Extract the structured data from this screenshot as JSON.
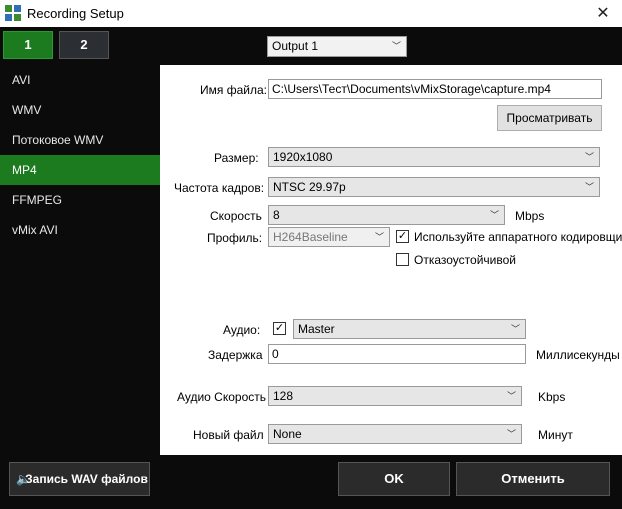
{
  "window": {
    "title": "Recording Setup",
    "close_glyph": "✕"
  },
  "tabs": [
    {
      "label": "1",
      "active": true
    },
    {
      "label": "2",
      "active": false
    }
  ],
  "output_select": {
    "value": "Output 1"
  },
  "formats": [
    {
      "label": "AVI"
    },
    {
      "label": "WMV"
    },
    {
      "label": "Потоковое WMV"
    },
    {
      "label": "MP4",
      "active": true
    },
    {
      "label": "FFMPEG"
    },
    {
      "label": "vMix AVI"
    }
  ],
  "settings": {
    "filename_label": "Имя файла:",
    "filename_value": "C:\\Users\\Тест\\Documents\\vMixStorage\\capture.mp4",
    "browse_label": "Просматривать",
    "size_label": "Размер:",
    "size_value": "1920x1080",
    "framerate_label": "Частота кадров:",
    "framerate_value": "NTSC 29.97p",
    "bitrate_label": "Скорость",
    "bitrate_value": "8",
    "bitrate_unit": "Mbps",
    "profile_label": "Профиль:",
    "profile_value": "H264Baseline",
    "hw_encoder_label": "Используйте аппаратного кодировщика",
    "hw_encoder_checked": true,
    "failsafe_label": "Отказоустойчивой",
    "failsafe_checked": false,
    "audio_label": "Аудио:",
    "audio_checked": true,
    "audio_value": "Master",
    "delay_label": "Задержка",
    "delay_value": "0",
    "delay_unit": "Миллисекунды",
    "audio_bitrate_label": "Аудио Скорость",
    "audio_bitrate_value": "128",
    "audio_bitrate_unit": "Kbps",
    "new_file_label": "Новый файл",
    "new_file_value": "None",
    "new_file_unit": "Минут"
  },
  "footer": {
    "wav_label": "Запись WAV файлов",
    "ok_label": "OK",
    "cancel_label": "Отменить"
  },
  "glyphs": {
    "check": "✓",
    "chevron": "﹀",
    "speaker": "🔈"
  },
  "colors": {
    "accent_green": "#1c7a1f",
    "background": "#0b0b0b"
  }
}
